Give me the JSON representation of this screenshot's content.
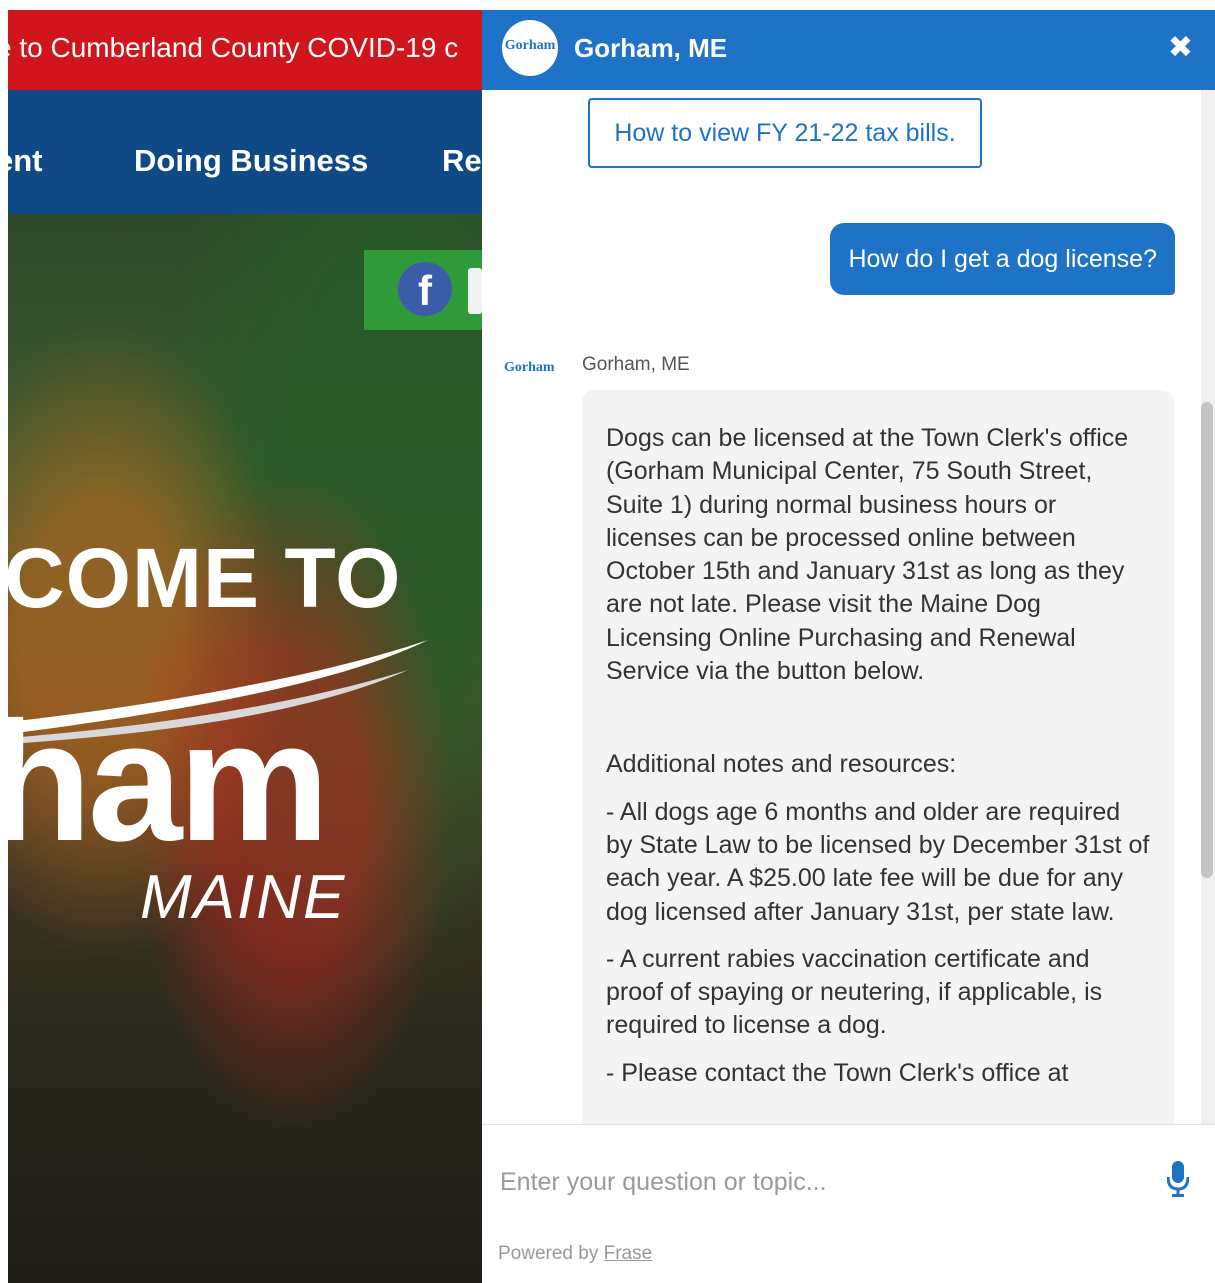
{
  "website": {
    "alert_text": "e to Cumberland County COVID-19 c",
    "nav_items": [
      "ent",
      "Doing Business",
      "Re"
    ],
    "hero": {
      "line1": "COME TO",
      "line2": "ham",
      "line3": "MAINE"
    },
    "social_icon": "f"
  },
  "chat": {
    "header": {
      "logo_text": "Gorham",
      "title": "Gorham, ME",
      "close_glyph": "✖"
    },
    "suggestion": "How to view FY 21-22 tax bills.",
    "user_message": "How do I get a dog license?",
    "bot": {
      "logo_text": "Gorham",
      "name": "Gorham, ME",
      "paragraphs": [
        "Dogs can be licensed at the Town Clerk's office (Gorham Municipal Center, 75 South Street, Suite 1) during normal business hours or licenses can be processed online between October 15th and January 31st as long as they are not late. Please visit the Maine Dog Licensing Online Purchasing and Renewal Service via the button below.",
        "Additional notes and resources:",
        "- All dogs age 6 months and older are required by State Law to be licensed by December 31st of each year. A $25.00 late fee will be due for any dog licensed after January 31st, per state law.",
        "- A current rabies vaccination certificate and proof of spaying or neutering, if applicable, is required to license a dog.",
        "- Please contact the Town Clerk's office at"
      ]
    },
    "input": {
      "placeholder": "Enter your question or topic..."
    },
    "powered_by": "Powered by",
    "powered_brand": "Frase",
    "colors": {
      "primary": "#1f73c6",
      "alert_red": "#d0161c",
      "nav_blue": "#0f4a86"
    }
  }
}
